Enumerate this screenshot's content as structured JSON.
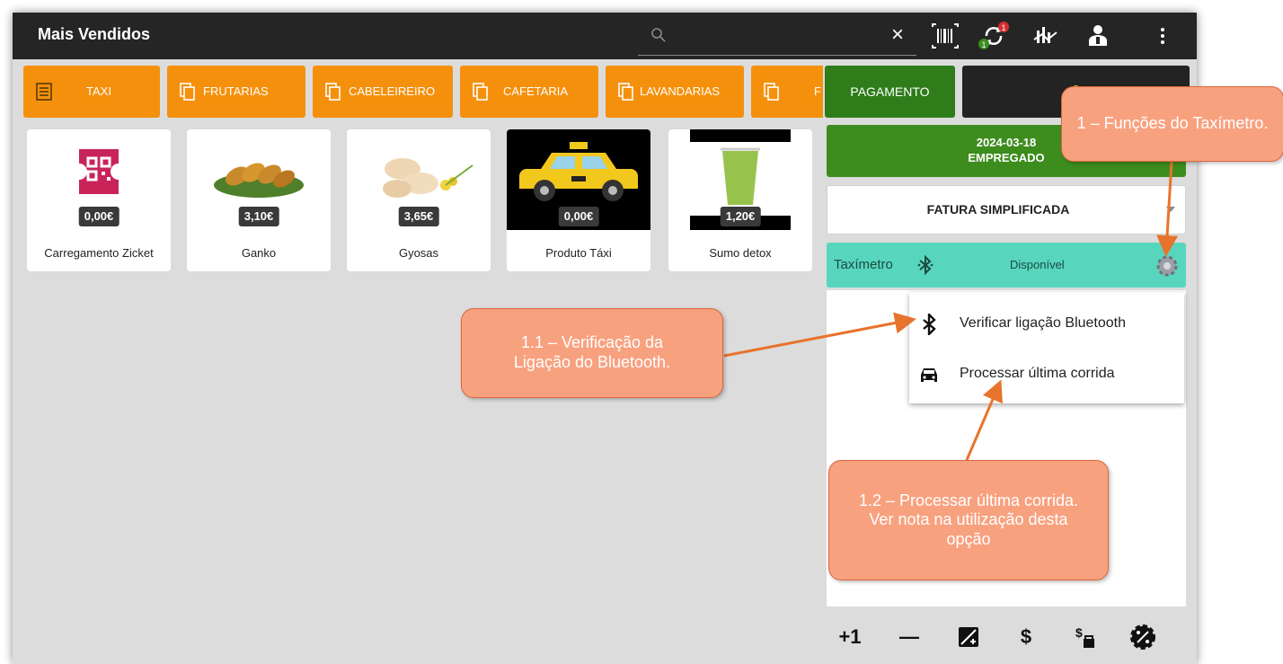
{
  "header": {
    "title": "Mais Vendidos",
    "clear_symbol": "×",
    "icons": [
      "search-icon",
      "barcode-icon",
      "sync-icon",
      "stats-icon",
      "user-icon",
      "more-vertical-icon"
    ],
    "sync_badge": "1",
    "sync_sub_badge": "1"
  },
  "categories": [
    {
      "label": "TAXI",
      "icon": "list-icon"
    },
    {
      "label": "FRUTARIAS",
      "icon": "copy-icon"
    },
    {
      "label": "CABELEIREIRO",
      "icon": "copy-icon"
    },
    {
      "label": "CAFETARIA",
      "icon": "copy-icon"
    },
    {
      "label": "LAVANDARIAS",
      "icon": "copy-icon"
    },
    {
      "label": "F",
      "icon": "copy-icon"
    }
  ],
  "products": [
    {
      "name": "Carregamento Zicket",
      "price": "0,00€"
    },
    {
      "name": "Ganko",
      "price": "3,10€"
    },
    {
      "name": "Gyosas",
      "price": "3,65€"
    },
    {
      "name": "Produto Táxi",
      "price": "0,00€"
    },
    {
      "name": "Sumo detox",
      "price": "1,20€"
    }
  ],
  "panel": {
    "pay_label": "PAGAMENTO",
    "total": "0",
    "date": "2024-03-18",
    "employee": "EMPREGADO",
    "document_type": "FATURA SIMPLIFICADA",
    "taximeter_label": "Taxímetro",
    "taximeter_status": "Disponível",
    "menu": [
      {
        "label": "Verificar ligação Bluetooth",
        "icon": "bluetooth-icon"
      },
      {
        "label": "Processar última corrida",
        "icon": "car-icon"
      }
    ],
    "bottom_buttons": [
      "+1",
      "—",
      "edit-icon",
      "$",
      "price-tag-icon",
      "discount-icon"
    ]
  },
  "callouts": {
    "functions": "1 – Funções do Taxímetro.",
    "bluetooth": "1.1 – Verificação da Ligação do Bluetooth.",
    "last_ride": "1.2 – Processar última corrida. Ver nota na utilização desta opção"
  },
  "colors": {
    "topbar": "#252525",
    "category": "#f5900c",
    "pay": "#2e7d1a",
    "employee": "#3d8c1e",
    "taximeter": "#57d6bd",
    "callout": "#f8a17f",
    "arrow": "#e8732c"
  }
}
